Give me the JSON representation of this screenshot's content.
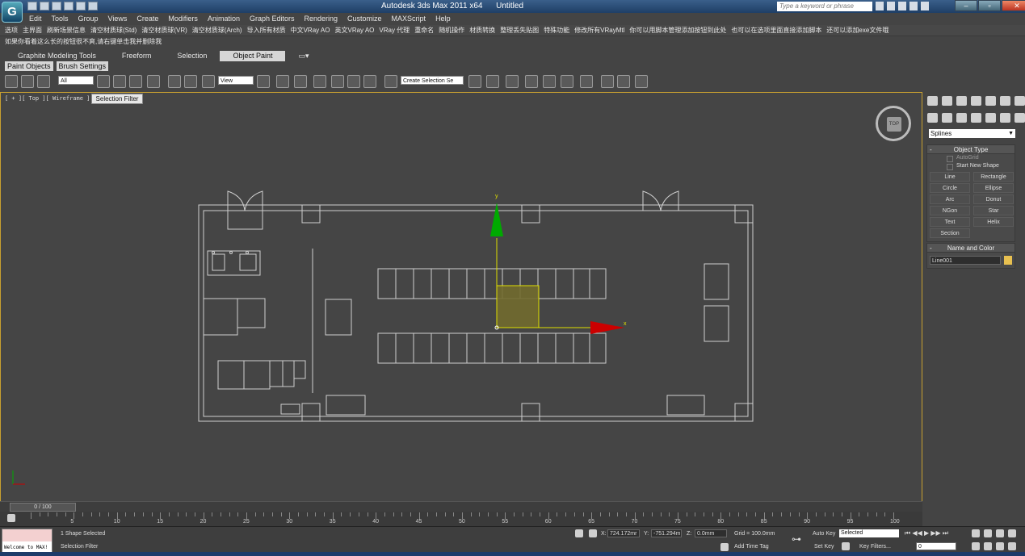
{
  "window": {
    "app_title": "Autodesk 3ds Max  2011 x64",
    "doc_title": "Untitled",
    "search_placeholder": "Type a keyword or phrase",
    "logo_glyph": "G"
  },
  "menu": [
    "Edit",
    "Tools",
    "Group",
    "Views",
    "Create",
    "Modifiers",
    "Animation",
    "Graph Editors",
    "Rendering",
    "Customize",
    "MAXScript",
    "Help"
  ],
  "custom_toolbar": [
    "选项",
    "主界面",
    "刷新场景信息",
    "清空材质球(Std)",
    "清空材质球(VR)",
    "清空材质球(Arch)",
    "导入所有材质",
    "中文VRay AO",
    "英文VRay AO",
    "VRay 代理",
    "重命名",
    "随机操作",
    "材质转换",
    "整理丢失贴图",
    "特殊功能",
    "修改所有VRayMtl",
    "你可以用脚本管理添加按钮到此处",
    "也可以在选项里面直接添加脚本",
    "还可以添加exe文件哦"
  ],
  "custom_toolbar_line2": "如果你看着这么长的按钮很不爽,请右键单击我并删除我",
  "ribbon": {
    "tabs": [
      "Graphite Modeling Tools",
      "Freeform",
      "Selection",
      "Object Paint"
    ],
    "active_tab": "Object Paint",
    "subtabs": [
      "Paint Objects",
      "Brush Settings"
    ]
  },
  "main_toolbar": {
    "filter_value": "All",
    "refcoord_value": "View",
    "named_selection_value": "Create Selection Se"
  },
  "tooltip": "Selection Filter",
  "viewport": {
    "label": "[ + ][ Top ][ Wireframe ]",
    "viewcube_label": "TOP",
    "axis_x": "x",
    "axis_y": "y"
  },
  "command_panel": {
    "dropdown_value": "Splines",
    "object_type_title": "Object Type",
    "autogrid": "AutoGrid",
    "start_new_shape": "Start New Shape",
    "buttons": [
      "Line",
      "Rectangle",
      "Circle",
      "Ellipse",
      "Arc",
      "Donut",
      "NGon",
      "Star",
      "Text",
      "Helix",
      "Section"
    ],
    "name_color_title": "Name and Color",
    "object_name": "Line001",
    "object_color": "#e8c050"
  },
  "timeline": {
    "slider_label": "0 / 100",
    "ticks": [
      "5",
      "10",
      "15",
      "20",
      "25",
      "30",
      "35",
      "40",
      "45",
      "50",
      "55",
      "60",
      "65",
      "70",
      "75",
      "80",
      "85",
      "90",
      "95",
      "100"
    ]
  },
  "status": {
    "maxscript_text": "Welcome to MAX!",
    "selection_text": "1 Shape Selected",
    "prompt_text": "Selection Filter",
    "x_label": "X:",
    "x_value": "724.172mr",
    "y_label": "Y:",
    "y_value": "-751.294m",
    "z_label": "Z:",
    "z_value": "0.0mm",
    "grid": "Grid = 100.0mm",
    "add_time_tag": "Add Time Tag",
    "auto_key": "Auto Key",
    "auto_key_value": "Selected",
    "set_key": "Set Key",
    "key_filters": "Key Filters...",
    "frame_value": "0"
  },
  "colors": {
    "viewport_border": "#c8a030",
    "axis_x": "#cc0000",
    "axis_y": "#00aa00",
    "gizmo": "#e0e000"
  }
}
